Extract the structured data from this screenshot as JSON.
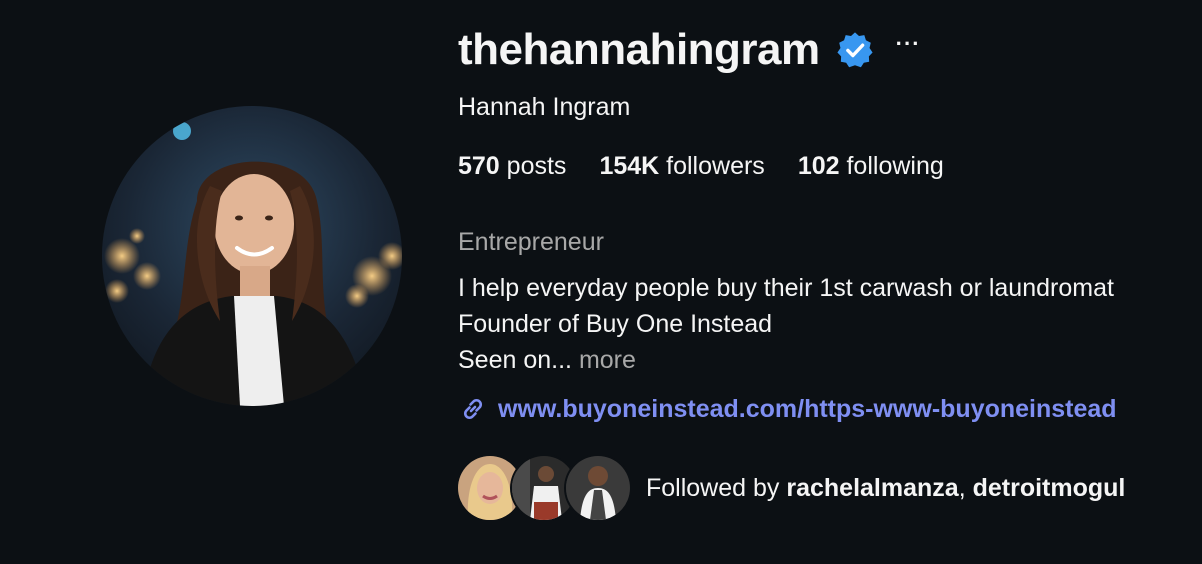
{
  "profile": {
    "username": "thehannahingram",
    "verified_icon": "verified-badge-icon",
    "more_icon": "more-options-icon",
    "more_glyph": "···",
    "full_name": "Hannah Ingram",
    "stats": {
      "posts_count": "570",
      "posts_label": "posts",
      "followers_count": "154K",
      "followers_label": "followers",
      "following_count": "102",
      "following_label": "following"
    },
    "category": "Entrepreneur",
    "bio": {
      "line1": "I help everyday people buy their 1st carwash or laundromat",
      "line2": "Founder of Buy One Instead",
      "line3": "Seen on...",
      "more_label": "more"
    },
    "link": {
      "icon": "link-icon",
      "text": "www.buyoneinstead.com/https-www-buyoneinstead"
    },
    "followed_by": {
      "prefix": "Followed by",
      "user1": "rachelalmanza",
      "separator": ",",
      "user2": "detroitmogul"
    }
  },
  "colors": {
    "background": "#0c1014",
    "text": "#f5f5f5",
    "secondary_text": "#a8a8a8",
    "link": "#7f8ff2",
    "verified": "#3897f0"
  }
}
